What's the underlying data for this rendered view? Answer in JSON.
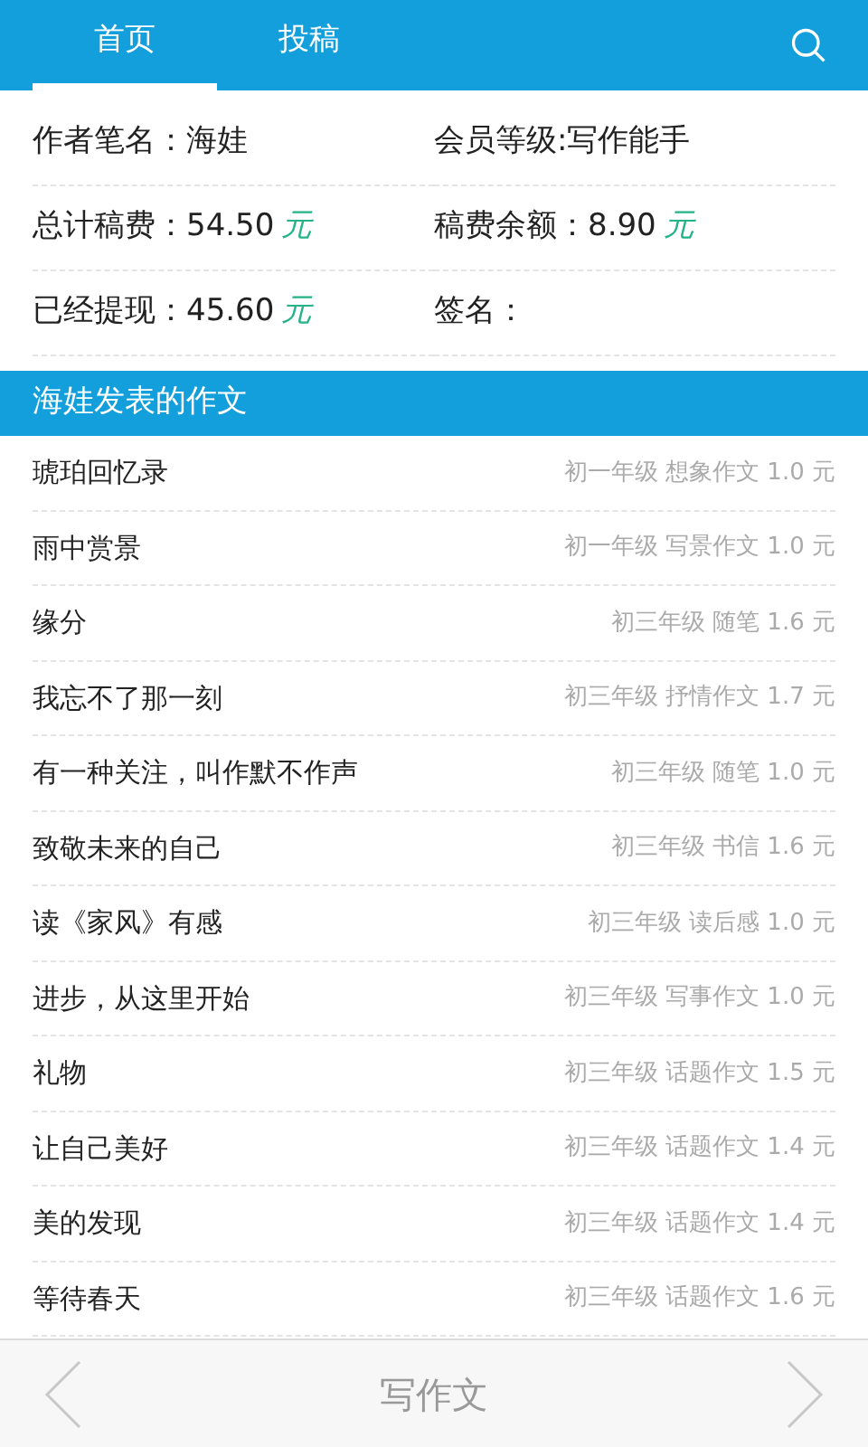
{
  "tabs": [
    {
      "label": "首页",
      "selected": true
    },
    {
      "label": "投稿",
      "selected": false
    }
  ],
  "profile": [
    {
      "label": "作者笔名：",
      "value": "海娃"
    },
    {
      "label": "会员等级:",
      "value": "写作能手"
    },
    {
      "label": "总计稿费：",
      "value": "54.50",
      "unit": "元"
    },
    {
      "label": "稿费余额：",
      "value": "8.90",
      "unit": "元"
    },
    {
      "label": "已经提现：",
      "value": "45.60",
      "unit": "元"
    },
    {
      "label": "签名："
    }
  ],
  "section_title": "海娃发表的作文",
  "essays": [
    {
      "title": "琥珀回忆录",
      "meta": "初一年级 想象作文 1.0 元"
    },
    {
      "title": "雨中赏景",
      "meta": "初一年级 写景作文 1.0 元"
    },
    {
      "title": "缘分",
      "meta": "初三年级 随笔 1.6 元"
    },
    {
      "title": "我忘不了那一刻",
      "meta": "初三年级 抒情作文 1.7 元"
    },
    {
      "title": "有一种关注，叫作默不作声",
      "meta": "初三年级 随笔 1.0 元"
    },
    {
      "title": "致敬未来的自己",
      "meta": "初三年级 书信 1.6 元"
    },
    {
      "title": "读《家风》有感",
      "meta": "初三年级 读后感 1.0 元"
    },
    {
      "title": "进步，从这里开始",
      "meta": "初三年级 写事作文 1.0 元"
    },
    {
      "title": "礼物",
      "meta": "初三年级 话题作文 1.5 元"
    },
    {
      "title": "让自己美好",
      "meta": "初三年级 话题作文 1.4 元"
    },
    {
      "title": "美的发现",
      "meta": "初三年级 话题作文 1.4 元"
    },
    {
      "title": "等待春天",
      "meta": "初三年级 话题作文 1.6 元"
    }
  ],
  "bottom_bar": {
    "label": "写作文"
  }
}
